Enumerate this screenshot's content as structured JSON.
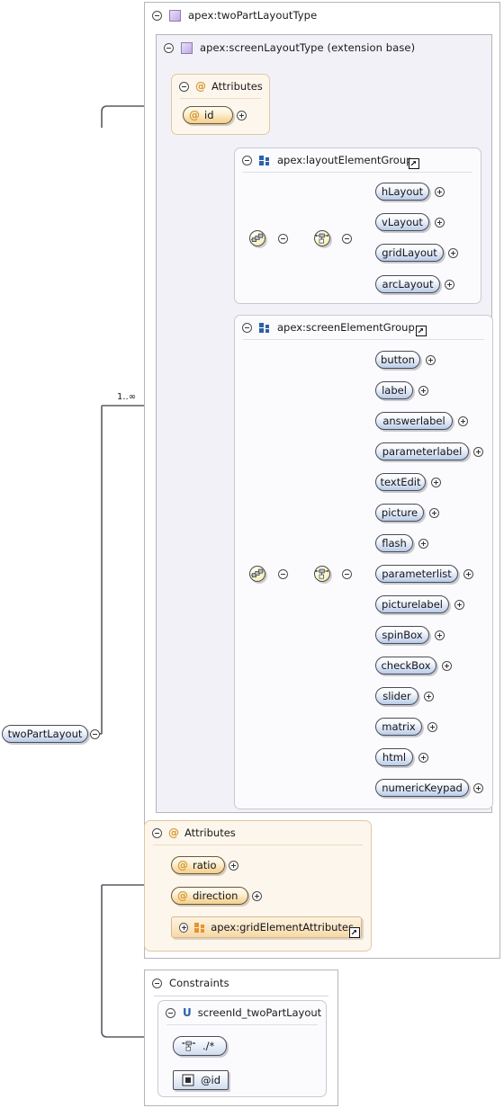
{
  "root": {
    "label": "twoPartLayout",
    "occurrence": "1..∞"
  },
  "complex_type": {
    "label": "apex:twoPartLayoutType",
    "icon": "complextype-icon"
  },
  "extension_base": {
    "label": "apex:screenLayoutType (extension base)",
    "icon": "complextype-icon"
  },
  "base_attributes": {
    "header": "Attributes",
    "header_icon": "at-icon",
    "items": [
      {
        "label": "id",
        "icon": "at-icon"
      }
    ]
  },
  "layout_element_group": {
    "label": "apex:layoutElementGroup",
    "icon": "group-icon",
    "link_icon": "external-link-icon",
    "connectors": [
      "choice-icon",
      "sequence-icon"
    ],
    "elements": [
      {
        "label": "hLayout"
      },
      {
        "label": "vLayout"
      },
      {
        "label": "gridLayout"
      },
      {
        "label": "arcLayout"
      }
    ]
  },
  "screen_element_group": {
    "label": "apex:screenElementGroup",
    "icon": "group-icon",
    "link_icon": "external-link-icon",
    "connectors": [
      "choice-icon",
      "sequence-icon"
    ],
    "elements": [
      {
        "label": "button"
      },
      {
        "label": "label"
      },
      {
        "label": "answerlabel"
      },
      {
        "label": "parameterlabel"
      },
      {
        "label": "textEdit"
      },
      {
        "label": "picture"
      },
      {
        "label": "flash"
      },
      {
        "label": "parameterlist"
      },
      {
        "label": "picturelabel"
      },
      {
        "label": "spinBox"
      },
      {
        "label": "checkBox"
      },
      {
        "label": "slider"
      },
      {
        "label": "matrix"
      },
      {
        "label": "html"
      },
      {
        "label": "numericKeypad"
      }
    ]
  },
  "own_attributes": {
    "header": "Attributes",
    "header_icon": "at-icon",
    "items": [
      {
        "label": "ratio",
        "icon": "at-icon"
      },
      {
        "label": "direction",
        "icon": "at-icon"
      }
    ],
    "reference": {
      "label": "apex:gridElementAttributes",
      "icon": "attribute-group-icon",
      "link_icon": "external-link-icon"
    }
  },
  "constraints": {
    "header": "Constraints",
    "unique": {
      "marker": "U",
      "label": "screenId_twoPartLayout",
      "selector": {
        "label": "./*",
        "icon": "selector-icon"
      },
      "field": {
        "label": "@id",
        "icon": "field-icon"
      }
    }
  }
}
